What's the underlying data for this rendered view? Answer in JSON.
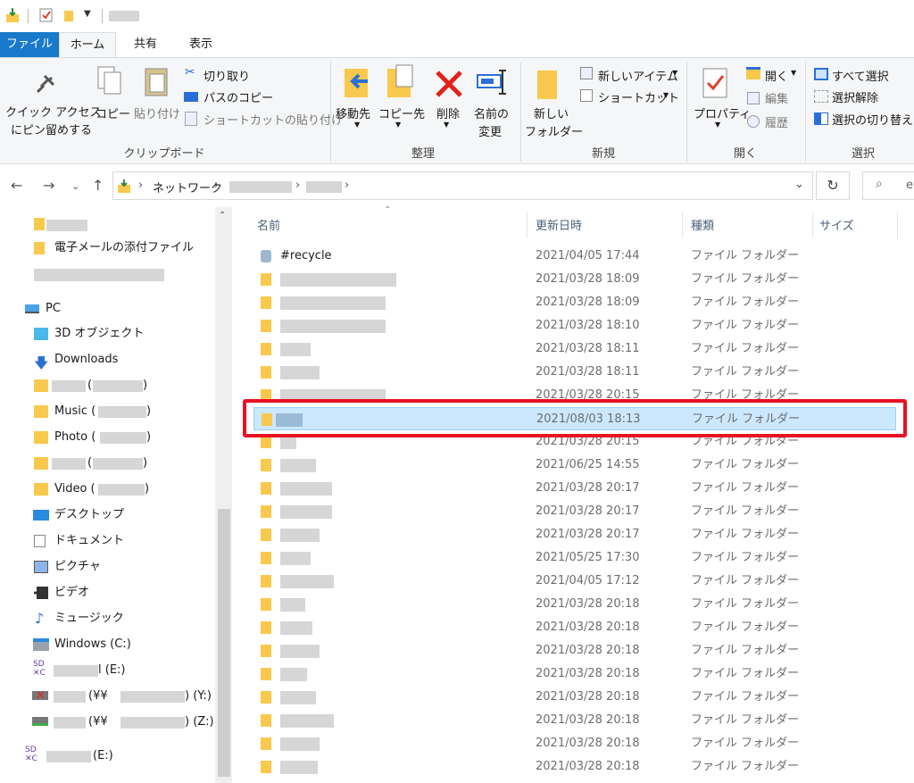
{
  "ribbon_tabs": [
    {
      "label": "ファイル"
    },
    {
      "label": "ホーム"
    },
    {
      "label": "共有"
    },
    {
      "label": "表示"
    }
  ],
  "clipboard": {
    "pin_label_1": "クイック アクセス",
    "pin_label_2": "にピン留めする",
    "copy": "コピー",
    "paste": "貼り付け",
    "cut": "切り取り",
    "copy_path": "パスのコピー",
    "paste_shortcut": "ショートカットの貼り付け",
    "group": "クリップボード"
  },
  "organize": {
    "move_to": "移動先",
    "copy_to": "コピー先",
    "delete": "削除",
    "rename_1": "名前の",
    "rename_2": "変更",
    "group": "整理"
  },
  "new": {
    "new_folder_1": "新しい",
    "new_folder_2": "フォルダー",
    "new_item": "新しいアイテム",
    "shortcut": "ショートカット",
    "group": "新規"
  },
  "open": {
    "properties": "プロパティ",
    "open": "開く",
    "edit": "編集",
    "history": "履歴",
    "group": "開く"
  },
  "select": {
    "select_all": "すべて選択",
    "select_none": "選択解除",
    "invert": "選択の切り替え",
    "group": "選択"
  },
  "address": {
    "network": "ネットワーク",
    "search_partial": "ei"
  },
  "navpane": {
    "email_attach": "電子メールの添付ファイル",
    "pc": "PC",
    "objects3d": "3D オブジェクト",
    "downloads": "Downloads",
    "paren_open": "(",
    "paren_close": ")",
    "music": "Music (",
    "photo": "Photo (",
    "video": "Video (",
    "desktop": "デスクトップ",
    "documents": "ドキュメント",
    "pictures": "ピクチャ",
    "videos": "ビデオ",
    "music_jp": "ミュージック",
    "windows": "Windows (C:)",
    "e_drive": "l (E:)",
    "y_drive_a": "(¥¥",
    "y_drive_b": ") (Y:)",
    "z_drive_a": "(¥¥",
    "z_drive_b": ") (Z:)",
    "e_drive2": "(E:)"
  },
  "columns": {
    "name": "名前",
    "modified": "更新日時",
    "type": "種類",
    "size": "サイズ"
  },
  "files": [
    {
      "name": "#recycle",
      "date": "2021/04/05 17:44",
      "type": "ファイル フォルダー"
    },
    {
      "name": "",
      "date": "2021/03/28 18:09",
      "type": "ファイル フォルダー"
    },
    {
      "name": "",
      "date": "2021/03/28 18:09",
      "type": "ファイル フォルダー"
    },
    {
      "name": "",
      "date": "2021/03/28 18:10",
      "type": "ファイル フォルダー"
    },
    {
      "name": "",
      "date": "2021/03/28 18:11",
      "type": "ファイル フォルダー"
    },
    {
      "name": "",
      "date": "2021/03/28 18:11",
      "type": "ファイル フォルダー"
    },
    {
      "name": "",
      "date": "2021/03/28 20:15",
      "type": "ファイル フォルダー"
    },
    {
      "name": "",
      "date": "2021/08/03 18:13",
      "type": "ファイル フォルダー"
    },
    {
      "name": "",
      "date": "2021/03/28 20:15",
      "type": "ファイル フォルダー"
    },
    {
      "name": "",
      "date": "2021/06/25 14:55",
      "type": "ファイル フォルダー"
    },
    {
      "name": "",
      "date": "2021/03/28 20:17",
      "type": "ファイル フォルダー"
    },
    {
      "name": "",
      "date": "2021/03/28 20:17",
      "type": "ファイル フォルダー"
    },
    {
      "name": "",
      "date": "2021/03/28 20:17",
      "type": "ファイル フォルダー"
    },
    {
      "name": "",
      "date": "2021/05/25 17:30",
      "type": "ファイル フォルダー"
    },
    {
      "name": "",
      "date": "2021/04/05 17:12",
      "type": "ファイル フォルダー"
    },
    {
      "name": "",
      "date": "2021/03/28 20:18",
      "type": "ファイル フォルダー"
    },
    {
      "name": "",
      "date": "2021/03/28 20:18",
      "type": "ファイル フォルダー"
    },
    {
      "name": "",
      "date": "2021/03/28 20:18",
      "type": "ファイル フォルダー"
    },
    {
      "name": "",
      "date": "2021/03/28 20:18",
      "type": "ファイル フォルダー"
    },
    {
      "name": "",
      "date": "2021/03/28 20:18",
      "type": "ファイル フォルダー"
    },
    {
      "name": "",
      "date": "2021/03/28 20:18",
      "type": "ファイル フォルダー"
    },
    {
      "name": "",
      "date": "2021/03/28 20:18",
      "type": "ファイル フォルダー"
    },
    {
      "name": "",
      "date": "2021/03/28 20:18",
      "type": "ファイル フォルダー"
    }
  ],
  "colors": {
    "file_tab": "#1979ca",
    "selection": "#cce8ff",
    "highlight_box": "#e81123",
    "folder": "#f8c94c"
  }
}
